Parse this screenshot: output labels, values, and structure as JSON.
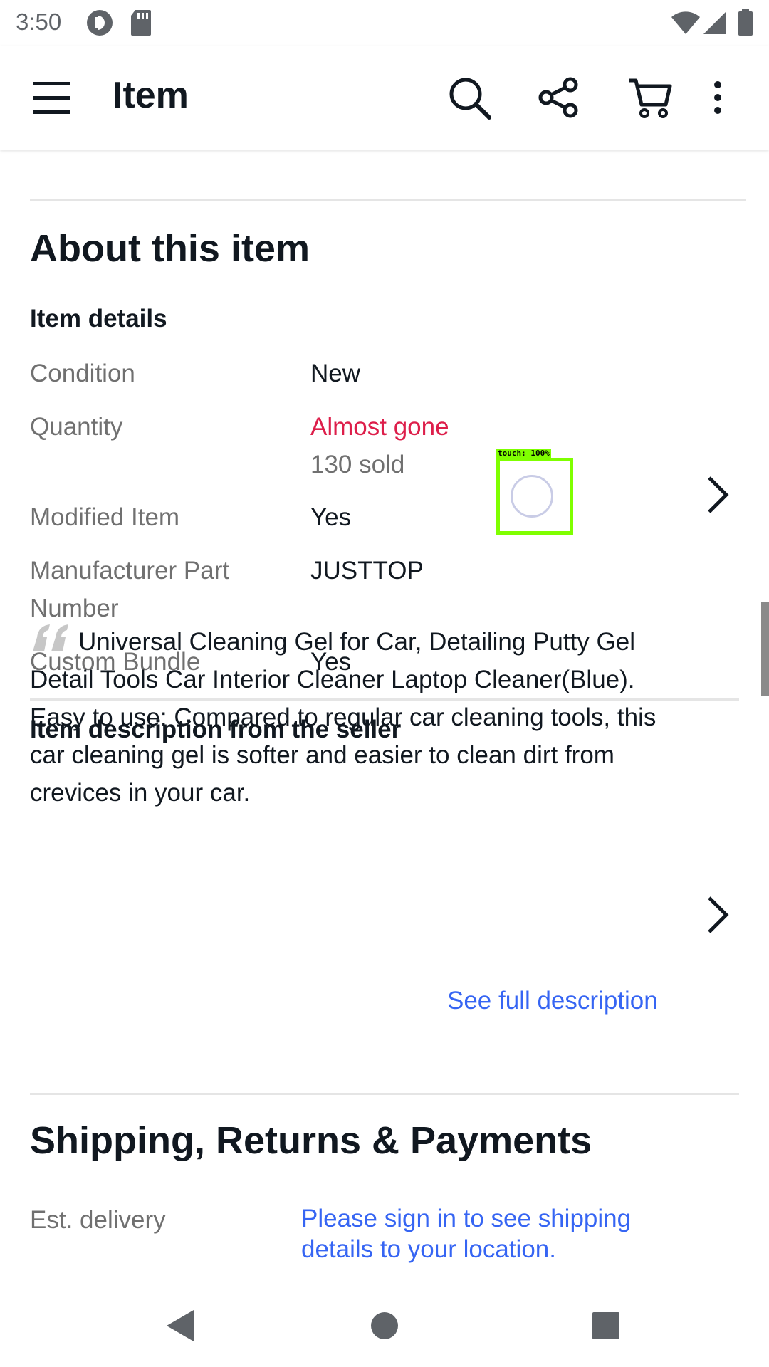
{
  "status_bar": {
    "time": "3:50",
    "icons": [
      "pocket-casts-icon",
      "sd-card-icon",
      "wifi-icon",
      "cellular-signal-icon",
      "battery-icon"
    ]
  },
  "app_bar": {
    "title": "Item",
    "icons": [
      "menu-icon",
      "search-icon",
      "share-icon",
      "cart-icon",
      "more-vert-icon"
    ]
  },
  "about": {
    "title": "About this item",
    "details_title": "Item details",
    "rows": [
      {
        "label": "Condition",
        "value": "New"
      },
      {
        "label": "Quantity",
        "value": "Almost gone",
        "secondary": "130 sold"
      },
      {
        "label": "Modified Item",
        "value": "Yes"
      },
      {
        "label": "Manufacturer Part Number",
        "value": "JUSTTOP"
      },
      {
        "label": "Custom Bundle",
        "value": "Yes"
      }
    ]
  },
  "description": {
    "title": "Item description from the seller",
    "text": "Universal Cleaning Gel for Car, Detailing Putty Gel Detail Tools Car Interior Cleaner Laptop Cleaner(Blue). Easy to use: Compared to regular car cleaning tools, this car cleaning gel is softer and easier to clean dirt from crevices in your car.",
    "link": "See full description"
  },
  "shipping": {
    "title": "Shipping, Returns & Payments",
    "delivery_label": "Est. delivery",
    "delivery_link": "Please sign in to see shipping details to your location."
  },
  "touch_overlay": {
    "label": "touch: 100%"
  },
  "colors": {
    "accent_link": "#3665f3",
    "alert_red": "#dd1e4a",
    "touch_green": "#7fff00"
  },
  "nav_bar": {
    "icons": [
      "back-icon",
      "home-icon",
      "recents-icon"
    ]
  }
}
